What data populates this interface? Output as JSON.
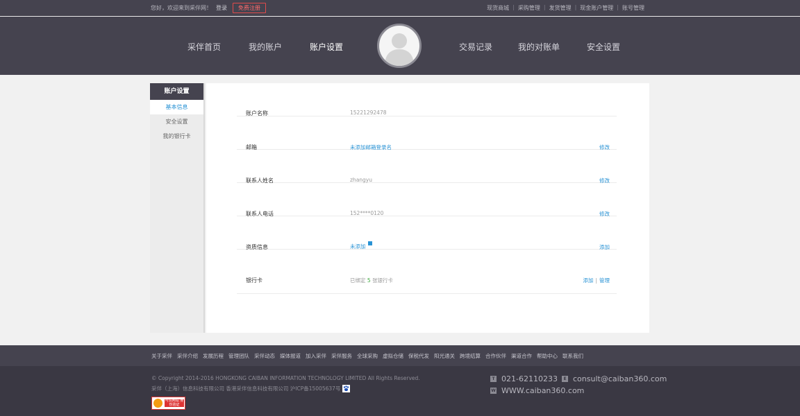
{
  "topbar": {
    "welcome": "您好，欢迎来到采伴网！",
    "login": "登录",
    "register": "免费注册",
    "links": [
      "现货商城",
      "采购管理",
      "发货管理",
      "现金账户管理",
      "账号管理"
    ]
  },
  "nav": {
    "items": [
      "采伴首页",
      "我的账户",
      "账户设置",
      "交易记录",
      "我的对账单",
      "安全设置"
    ],
    "active": "账户设置"
  },
  "sidebar": {
    "title": "账户设置",
    "items": [
      "基本信息",
      "安全设置",
      "我的银行卡"
    ],
    "active": "基本信息"
  },
  "info": {
    "rows": [
      {
        "label": "账户名称",
        "value": "15221292478",
        "action": ""
      },
      {
        "label": "邮箱",
        "value": "未添加邮箱登录名",
        "action": "修改"
      },
      {
        "label": "联系人姓名",
        "value": "zhangyu",
        "action": "修改"
      },
      {
        "label": "联系人电话",
        "value": "152****0120",
        "action": "修改"
      },
      {
        "label": "资质信息",
        "value": "未添加",
        "action": "添加"
      },
      {
        "label": "银行卡",
        "value_prefix": "已绑定",
        "value_count": "5",
        "value_suffix": "张银行卡",
        "action_add": "添加",
        "action_sep": "|",
        "action_manage": "管理"
      }
    ]
  },
  "footer": {
    "links": [
      "关于采伴",
      "采伴介绍",
      "发展历程",
      "管理团队",
      "采伴动态",
      "媒体报道",
      "加入采伴",
      "采伴服务",
      "全球采购",
      "虚拟仓储",
      "保税代发",
      "阳光通关",
      "跨境结算",
      "合作伙伴",
      "渠道合作",
      "帮助中心",
      "联系我们"
    ],
    "copyright": "© Copyright 2014-2016 HONGKONG CAIBAN INFORMATION TECHNOLOGY LIMITED All Rights Reserved.",
    "icp": "采伴（上海）信息科技有限公司 香港采伴信息科技有限公司 沪ICP备15005637号",
    "phone": "021-62110233",
    "email": "consult@caiban360.com",
    "website": "WWW.caiban360.com",
    "trust_badge": "可信网站 身份验证"
  },
  "colors": {
    "header_bg": "#45434f",
    "accent": "#2a93d5",
    "register_red": "#e24b4b"
  }
}
